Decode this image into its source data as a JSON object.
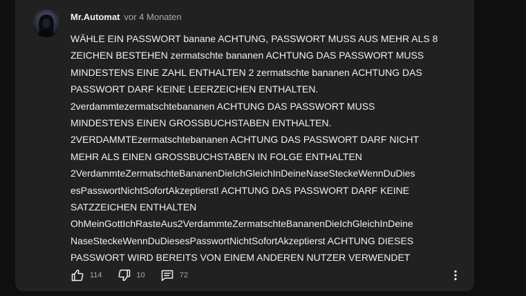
{
  "comment": {
    "author": "Mr.Automat",
    "time": "vor 4 Monaten",
    "lines": [
      "WÄHLE EIN PASSWORT banane ACHTUNG, PASSWORT MUSS AUS MEHR ALS 8",
      "ZEICHEN BESTEHEN zermatschte bananen ACHTUNG DAS PASSWORT MUSS",
      "MINDESTENS EINE ZAHL ENTHALTEN 2 zermatschte bananen ACHTUNG DAS",
      "PASSWORT DARF KEINE LEERZEICHEN ENTHALTEN.",
      "2verdammtezermatschtebananen ACHTUNG DAS PASSWORT MUSS",
      "MINDESTENS EINEN GROSSBUCHSTABEN ENTHALTEN.",
      "2VERDAMMTEzermatschtebananen ACHTUNG DAS PASSWORT DARF NICHT",
      "MEHR ALS EINEN GROSSBUCHSTABEN IN FOLGE ENTHALTEN",
      "2VerdammteZermatschteBananenDieIchGleichInDeineNaseSteckeWennDuDies",
      "esPasswortNichtSofortAkzeptierst! ACHTUNG DAS PASSWORT DARF KEINE",
      "SATZZEICHEN ENTHALTEN",
      "OhMeinGottIchRasteAus2VerdammteZermatschteBananenDieIchGleichInDeine",
      "NaseSteckeWennDuDiesesPasswortNichtSofortAkzeptierst ACHTUNG DIESES",
      "PASSWORT WIRD BEREITS VON EINEM ANDEREN NUTZER VERWENDET"
    ],
    "likes": "114",
    "dislikes": "10",
    "replies": "72"
  },
  "icons": {
    "avatar": "hooded-figure-avatar",
    "like": "thumbs-up-icon",
    "dislike": "thumbs-down-icon",
    "replies": "comment-icon",
    "more": "more-vertical-icon"
  },
  "colors": {
    "page_background": "#0f0f0f",
    "card_background": "#212121",
    "text_primary": "#f1f1f1",
    "text_secondary": "#aaaaaa"
  }
}
